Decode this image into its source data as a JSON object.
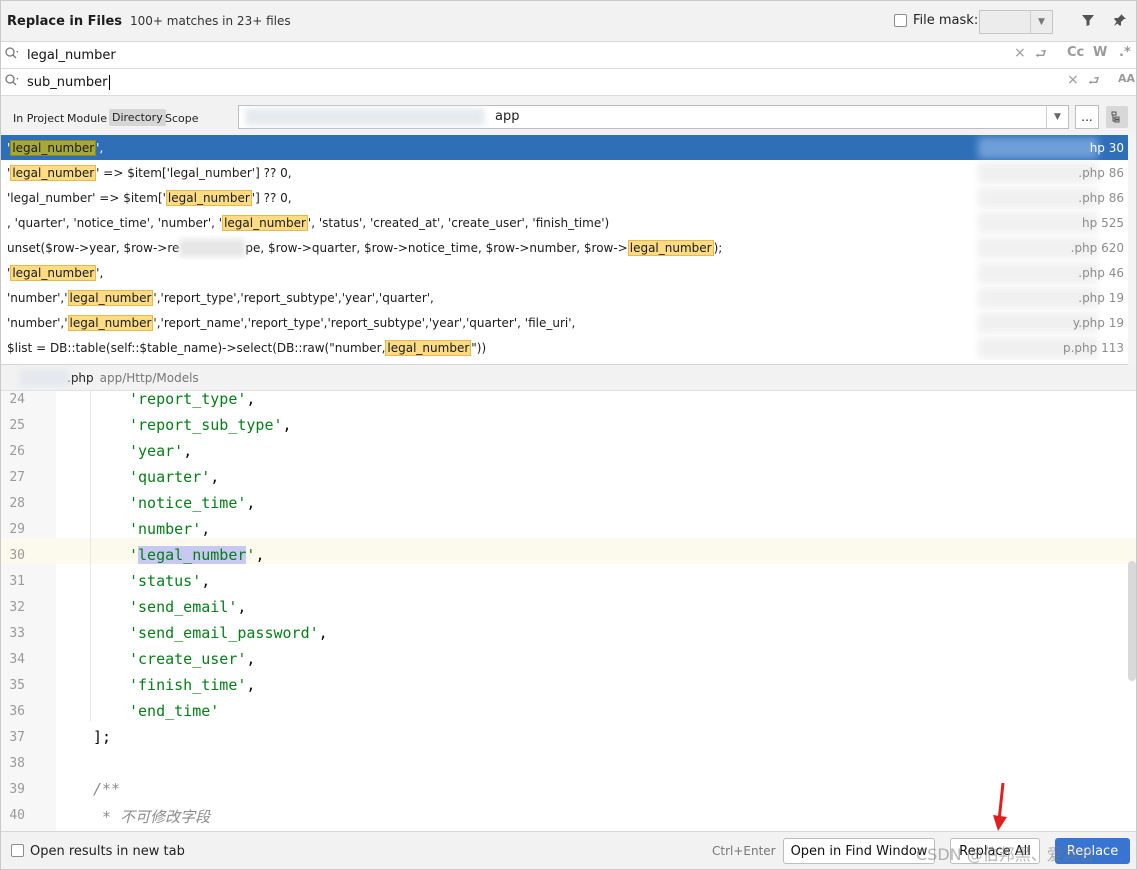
{
  "header": {
    "title": "Replace in Files",
    "match_summary": "100+ matches in 23+ files",
    "file_mask_label": "File mask:",
    "filter_icon": "filter-icon",
    "pin_icon": "pin-icon"
  },
  "search": {
    "find_value": "legal_number",
    "replace_value": "sub_number",
    "find_options": [
      "Cc",
      "W",
      ".*"
    ],
    "replace_options": [
      "AA"
    ]
  },
  "scope": {
    "tabs": [
      "In Project",
      "Module",
      "Directory",
      "Scope"
    ],
    "selected": "Directory",
    "directory_value": "app",
    "browse_label": "..."
  },
  "results": [
    {
      "pre": "'",
      "match": "legal_number",
      "post": "',",
      "file": "hp 30",
      "selected": true
    },
    {
      "pre": "'",
      "match": "legal_number",
      "post": "' => $item['legal_number'] ?? 0,",
      "file": ".php 86"
    },
    {
      "pre": "'legal_number' => $item['",
      "match": "legal_number",
      "post": "'] ?? 0,",
      "file": ".php 86"
    },
    {
      "pre": ", 'quarter', 'notice_time', 'number', '",
      "match": "legal_number",
      "post": "', 'status', 'created_at', 'create_user', 'finish_time')",
      "file": "hp 525"
    },
    {
      "pre": "unset($row->year, $row->re",
      "blurred": "",
      "mid": "pe, $row->quarter, $row->notice_time, $row->number, $row->",
      "match": "legal_number",
      "post": ");",
      "file": ".php 620"
    },
    {
      "pre": "'",
      "match": "legal_number",
      "post": "',",
      "file": ".php 46"
    },
    {
      "pre": "'number','",
      "match": "legal_number",
      "post": "','report_type','report_subtype','year','quarter',",
      "file": ".php 19"
    },
    {
      "pre": "'number','",
      "match": "legal_number",
      "post": "','report_name','report_type','report_subtype','year','quarter', 'file_uri',",
      "file": "y.php 19"
    },
    {
      "pre": "$list = DB::table(self::$table_name)->select(DB::raw(\"number,",
      "match": "legal_number",
      "post": "\"))",
      "file": "p.php 113"
    }
  ],
  "preview": {
    "file_name": ".php",
    "file_path": "app/Http/Models"
  },
  "editor": {
    "lines": [
      {
        "n": "24",
        "indent": 2,
        "text": "'report_type',"
      },
      {
        "n": "25",
        "indent": 2,
        "text": "'report_sub_type',"
      },
      {
        "n": "26",
        "indent": 2,
        "text": "'year',"
      },
      {
        "n": "27",
        "indent": 2,
        "text": "'quarter',"
      },
      {
        "n": "28",
        "indent": 2,
        "text": "'notice_time',"
      },
      {
        "n": "29",
        "indent": 2,
        "text": "'number',"
      },
      {
        "n": "30",
        "indent": 2,
        "text": "'legal_number',"
      },
      {
        "n": "31",
        "indent": 2,
        "text": "'status',"
      },
      {
        "n": "32",
        "indent": 2,
        "text": "'send_email',"
      },
      {
        "n": "33",
        "indent": 2,
        "text": "'send_email_password',"
      },
      {
        "n": "34",
        "indent": 2,
        "text": "'create_user',"
      },
      {
        "n": "35",
        "indent": 2,
        "text": "'finish_time',"
      },
      {
        "n": "36",
        "indent": 2,
        "text": "'end_time'"
      },
      {
        "n": "37",
        "indent": 1,
        "text": "];"
      },
      {
        "n": "38",
        "indent": 0,
        "text": ""
      },
      {
        "n": "39",
        "indent": 1,
        "text": "/**"
      },
      {
        "n": "40",
        "indent": 1,
        "text": " * 不可修改字段"
      }
    ]
  },
  "footer": {
    "open_new_tab_label": "Open results in new tab",
    "shortcut": "Ctrl+Enter",
    "open_find_window": "Open in Find Window",
    "replace_all": "Replace All",
    "replace": "Replace",
    "watermark": "CSDN @伯邦黑、爱其台"
  },
  "colors": {
    "selection": "#2e6fb8",
    "match_highlight": "#fbdb84",
    "primary_button": "#3874d0",
    "string_green": "#067d17"
  }
}
